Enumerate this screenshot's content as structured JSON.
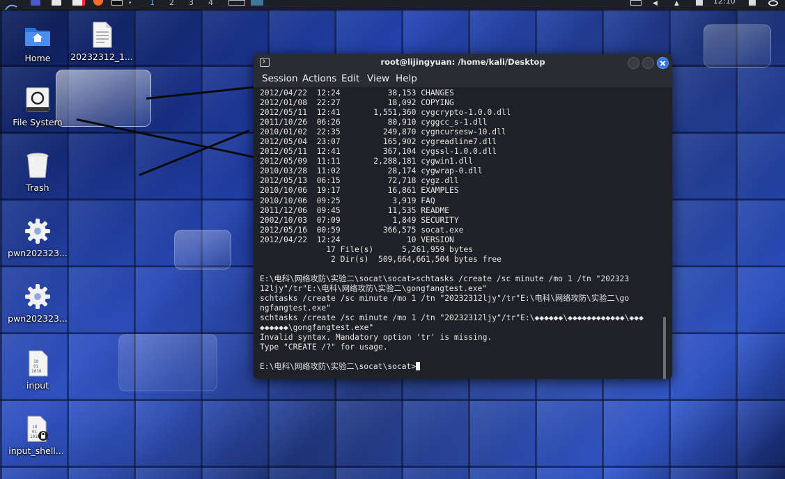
{
  "panel": {
    "workspaces": [
      "1",
      "2",
      "3",
      "4"
    ],
    "clock": "12:10",
    "icons": [
      "kali-menu-icon",
      "window-icon",
      "files-icon",
      "text-editor-icon",
      "firefox-icon",
      "terminal-icon"
    ]
  },
  "desktop": {
    "icons": [
      {
        "label": "Home",
        "icon": "home-folder-icon"
      },
      {
        "label": "20232312_1...",
        "icon": "text-file-icon"
      },
      {
        "label": "File System",
        "icon": "drive-icon"
      },
      {
        "label": "Trash",
        "icon": "trash-icon"
      },
      {
        "label": "pwn202323...",
        "icon": "gear-icon"
      },
      {
        "label": "pwn202323...",
        "icon": "gear-icon"
      },
      {
        "label": "input",
        "icon": "binary-file-icon"
      },
      {
        "label": "input_shell...",
        "icon": "binary-file-locked-icon"
      }
    ]
  },
  "terminal": {
    "title": "root@lijingyuan: /home/kali/Desktop",
    "menu": [
      "Session",
      "Actions",
      "Edit",
      "View",
      "Help"
    ],
    "lines": [
      "2012/04/22  12:24          38,153 CHANGES",
      "2012/01/08  22:27          18,092 COPYING",
      "2012/05/11  12:41       1,551,360 cygcrypto-1.0.0.dll",
      "2011/10/26  06:26          80,910 cyggcc_s-1.dll",
      "2010/01/02  22:35         249,870 cygncursesw-10.dll",
      "2012/05/04  23:07         165,902 cygreadline7.dll",
      "2012/05/11  12:41         367,104 cygssl-1.0.0.dll",
      "2012/05/09  11:11       2,288,181 cygwin1.dll",
      "2010/03/28  11:02          28,174 cygwrap-0.dll",
      "2012/05/13  06:15          72,718 cygz.dll",
      "2010/10/06  19:17          16,861 EXAMPLES",
      "2010/10/06  09:25           3,919 FAQ",
      "2011/12/06  09:45          11,535 README",
      "2002/10/03  07:09           1,849 SECURITY",
      "2012/05/16  00:59         366,575 socat.exe",
      "2012/04/22  12:24              10 VERSION",
      "              17 File(s)      5,261,959 bytes",
      "               2 Dir(s)  509,664,661,504 bytes free",
      "",
      "E:\\电科\\网络攻防\\实验二\\socat\\socat>schtasks /create /sc minute /mo 1 /tn \"202323",
      "12ljy\"/tr\"E:\\电科\\网络攻防\\实验二\\gongfangtest.exe\"",
      "schtasks /create /sc minute /mo 1 /tn \"20232312ljy\"/tr\"E:\\电科\\网络攻防\\实验二\\go",
      "ngfangtest.exe\"",
      "schtasks /create /sc minute /mo 1 /tn \"20232312ljy\"/tr\"E:\\◆◆◆◆◆◆\\◆◆◆◆◆◆◆◆◆◆◆◆\\◆◆◆",
      "◆◆◆◆◆◆\\gongfangtest.exe\"",
      "Invalid syntax. Mandatory option 'tr' is missing.",
      "Type \"CREATE /?\" for usage.",
      ""
    ],
    "prompt": "E:\\电科\\网络攻防\\实验二\\socat\\socat>"
  },
  "colors": {
    "accent": "#2f74e0",
    "terminal_bg": "#1f2127",
    "terminal_text": "#e6e6e6"
  }
}
